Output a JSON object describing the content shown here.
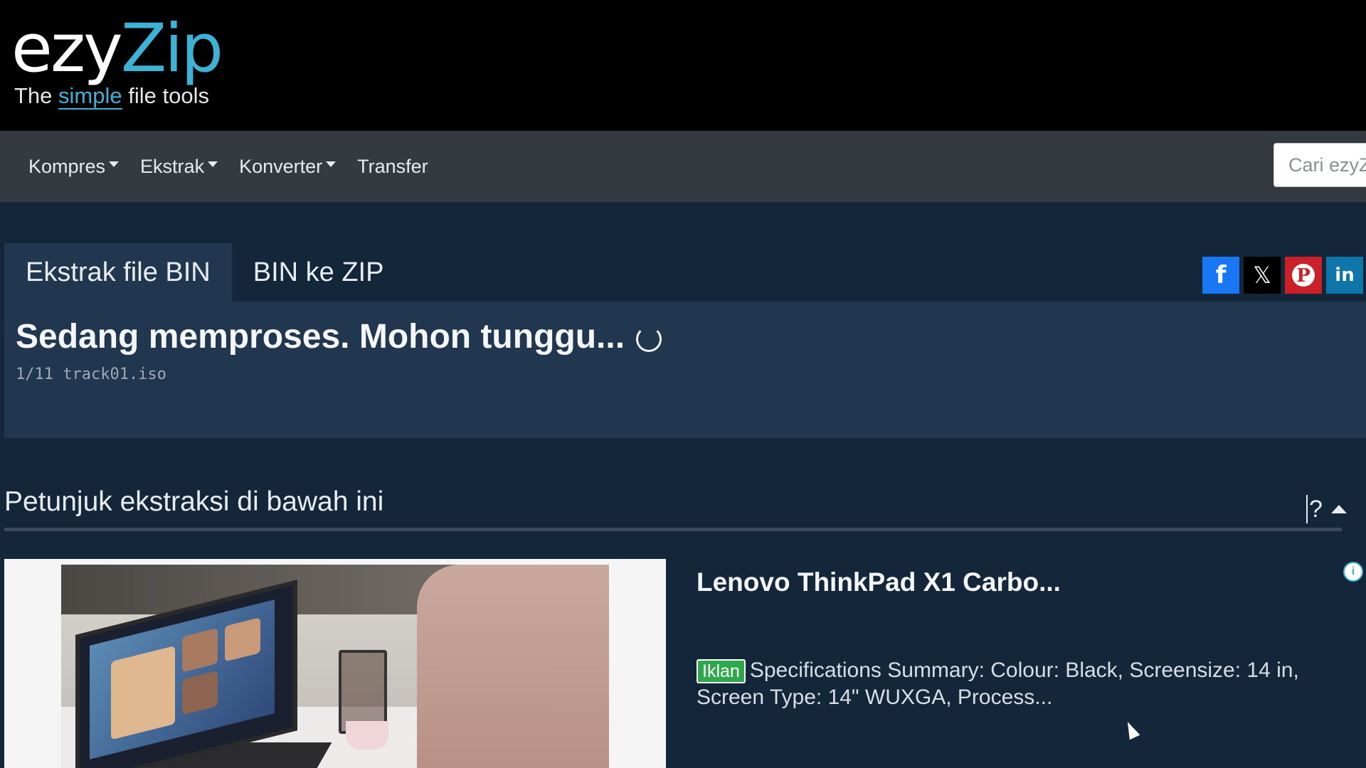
{
  "header": {
    "logo_ezy": "ezy",
    "logo_zip": "Zip",
    "tagline_pre": "The ",
    "tagline_simple": "simple",
    "tagline_post": " file tools"
  },
  "nav": {
    "items": [
      {
        "label": "Kompres",
        "dropdown": true
      },
      {
        "label": "Ekstrak",
        "dropdown": true
      },
      {
        "label": "Konverter",
        "dropdown": true
      },
      {
        "label": "Transfer",
        "dropdown": false
      }
    ],
    "search_placeholder": "Cari ezyZ"
  },
  "tabs": [
    {
      "label": "Ekstrak file BIN",
      "active": true
    },
    {
      "label": "BIN ke ZIP",
      "active": false
    }
  ],
  "social": {
    "facebook": "f",
    "x": "𝕏",
    "pinterest": "P",
    "linkedin": "in"
  },
  "status": {
    "title": "Sedang memproses. Mohon tunggu...",
    "progress_file": "1/11 track01.iso"
  },
  "instructions": {
    "title": "Petunjuk ekstraksi di bawah ini",
    "help": "?"
  },
  "ad": {
    "title": "Lenovo ThinkPad X1 Carbo...",
    "badge": "Iklan",
    "description": "Specifications Summary: Colour: Black, Screensize: 14 in, Screen Type: 14\" WUXGA, Process...",
    "adchoice": "i"
  },
  "colors": {
    "accent": "#3cb3d6",
    "background": "#13263a",
    "panel": "#21364f",
    "navbar": "#343a40",
    "ad_badge": "#2ea84a"
  }
}
